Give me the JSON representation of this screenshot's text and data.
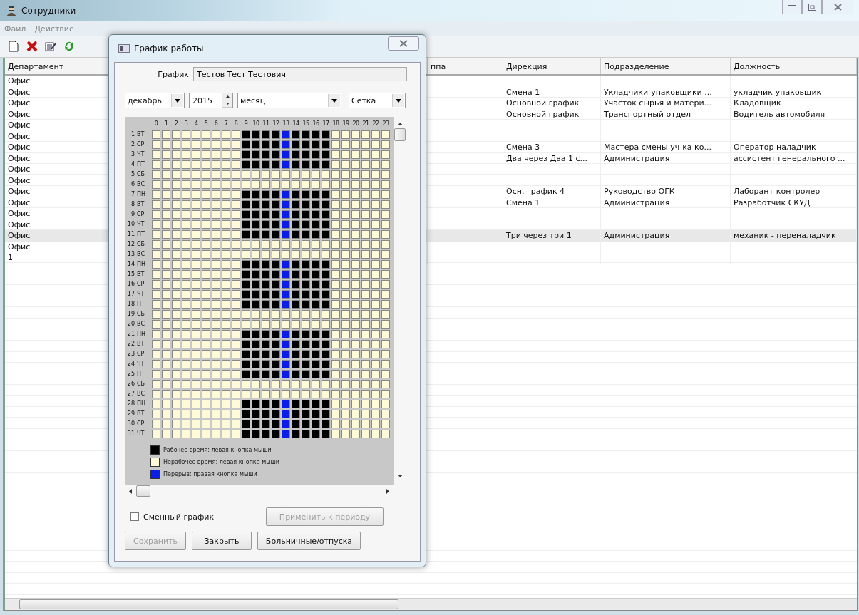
{
  "window": {
    "title": "Сотрудники"
  },
  "menu": [
    "Файл",
    "Действие"
  ],
  "table": {
    "columns": [
      "Департамент",
      "",
      "ппа",
      "Дирекция",
      "Подразделение",
      "Должность"
    ],
    "rows": [
      {
        "department": "Офис",
        "direction": "",
        "division": "",
        "position": "",
        "selected": false
      },
      {
        "department": "Офис",
        "direction": "Смена 1",
        "division": "Укладчики-упаковщики ...",
        "position": "укладчик-упаковщик",
        "selected": false
      },
      {
        "department": "Офис",
        "direction": "Основной график",
        "division": "Участок сырья и матери...",
        "position": "Кладовщик",
        "selected": false
      },
      {
        "department": "Офис",
        "direction": "Основной график",
        "division": "Транспортный отдел",
        "position": "Водитель автомобиля",
        "selected": false
      },
      {
        "department": "Офис",
        "direction": "",
        "division": "",
        "position": "",
        "selected": false
      },
      {
        "department": "Офис",
        "direction": "",
        "division": "",
        "position": "",
        "selected": false
      },
      {
        "department": "Офис",
        "direction": "Смена 3",
        "division": "Мастера смены уч-ка ко...",
        "position": "Оператор наладчик",
        "selected": false
      },
      {
        "department": "Офис",
        "direction": "Два через Два 1 с...",
        "division": "Администрация",
        "position": "ассистент генерального ...",
        "selected": false
      },
      {
        "department": "Офис",
        "direction": "",
        "division": "",
        "position": "",
        "selected": false
      },
      {
        "department": "Офис",
        "direction": "",
        "division": "",
        "position": "",
        "selected": false
      },
      {
        "department": "Офис",
        "direction": "Осн. график 4",
        "division": "Руководство ОГК",
        "position": "Лаборант-контролер",
        "selected": false
      },
      {
        "department": "Офис",
        "direction": "Смена 1",
        "division": "Администрация",
        "position": "Разработчик СКУД",
        "selected": false
      },
      {
        "department": "Офис",
        "direction": "",
        "division": "",
        "position": "",
        "selected": false
      },
      {
        "department": "Офис",
        "direction": "",
        "division": "",
        "position": "",
        "selected": false
      },
      {
        "department": "Офис",
        "direction": "Три через три 1",
        "division": "Администрация",
        "position": "механик - переналадчик",
        "selected": true
      },
      {
        "department": "Офис",
        "direction": "",
        "division": "",
        "position": "",
        "selected": false
      },
      {
        "department": "1",
        "direction": "",
        "division": "",
        "position": "",
        "selected": false
      }
    ]
  },
  "dialog": {
    "title": "График работы",
    "name_label": "График",
    "name_value": "Тестов Тест Тестович",
    "month": "декабрь",
    "year": "2015",
    "period": "месяц",
    "view": "Сетка",
    "hours": [
      "0",
      "1",
      "2",
      "3",
      "4",
      "5",
      "6",
      "7",
      "8",
      "9",
      "10",
      "11",
      "12",
      "13",
      "14",
      "15",
      "16",
      "17",
      "18",
      "19",
      "20",
      "21",
      "22",
      "23"
    ],
    "days": [
      {
        "day": "1",
        "weekday": "ВТ",
        "work": [
          false,
          false,
          false,
          false,
          false,
          false,
          false,
          false,
          false,
          true,
          true,
          true,
          true,
          false,
          true,
          true,
          true,
          true,
          false,
          false,
          false,
          false,
          false,
          false
        ],
        "break": [
          false,
          false,
          false,
          false,
          false,
          false,
          false,
          false,
          false,
          false,
          false,
          false,
          false,
          true,
          false,
          false,
          false,
          false,
          false,
          false,
          false,
          false,
          false,
          false
        ]
      },
      {
        "day": "2",
        "weekday": "СР",
        "work": [
          false,
          false,
          false,
          false,
          false,
          false,
          false,
          false,
          false,
          true,
          true,
          true,
          true,
          false,
          true,
          true,
          true,
          true,
          false,
          false,
          false,
          false,
          false,
          false
        ],
        "break": [
          false,
          false,
          false,
          false,
          false,
          false,
          false,
          false,
          false,
          false,
          false,
          false,
          false,
          true,
          false,
          false,
          false,
          false,
          false,
          false,
          false,
          false,
          false,
          false
        ]
      },
      {
        "day": "3",
        "weekday": "ЧТ",
        "work": [
          false,
          false,
          false,
          false,
          false,
          false,
          false,
          false,
          false,
          true,
          true,
          true,
          true,
          false,
          true,
          true,
          true,
          true,
          false,
          false,
          false,
          false,
          false,
          false
        ],
        "break": [
          false,
          false,
          false,
          false,
          false,
          false,
          false,
          false,
          false,
          false,
          false,
          false,
          false,
          true,
          false,
          false,
          false,
          false,
          false,
          false,
          false,
          false,
          false,
          false
        ]
      },
      {
        "day": "4",
        "weekday": "ПТ",
        "work": [
          false,
          false,
          false,
          false,
          false,
          false,
          false,
          false,
          false,
          true,
          true,
          true,
          true,
          false,
          true,
          true,
          true,
          true,
          false,
          false,
          false,
          false,
          false,
          false
        ],
        "break": [
          false,
          false,
          false,
          false,
          false,
          false,
          false,
          false,
          false,
          false,
          false,
          false,
          false,
          true,
          false,
          false,
          false,
          false,
          false,
          false,
          false,
          false,
          false,
          false
        ]
      },
      {
        "day": "5",
        "weekday": "СБ",
        "work": [
          false,
          false,
          false,
          false,
          false,
          false,
          false,
          false,
          false,
          false,
          false,
          false,
          false,
          false,
          false,
          false,
          false,
          false,
          false,
          false,
          false,
          false,
          false,
          false
        ],
        "break": [
          false,
          false,
          false,
          false,
          false,
          false,
          false,
          false,
          false,
          false,
          false,
          false,
          false,
          false,
          false,
          false,
          false,
          false,
          false,
          false,
          false,
          false,
          false,
          false
        ]
      },
      {
        "day": "6",
        "weekday": "ВС",
        "work": [
          false,
          false,
          false,
          false,
          false,
          false,
          false,
          false,
          false,
          false,
          false,
          false,
          false,
          false,
          false,
          false,
          false,
          false,
          false,
          false,
          false,
          false,
          false,
          false
        ],
        "break": [
          false,
          false,
          false,
          false,
          false,
          false,
          false,
          false,
          false,
          false,
          false,
          false,
          false,
          false,
          false,
          false,
          false,
          false,
          false,
          false,
          false,
          false,
          false,
          false
        ]
      },
      {
        "day": "7",
        "weekday": "ПН",
        "work": [
          false,
          false,
          false,
          false,
          false,
          false,
          false,
          false,
          false,
          true,
          true,
          true,
          true,
          false,
          true,
          true,
          true,
          true,
          false,
          false,
          false,
          false,
          false,
          false
        ],
        "break": [
          false,
          false,
          false,
          false,
          false,
          false,
          false,
          false,
          false,
          false,
          false,
          false,
          false,
          true,
          false,
          false,
          false,
          false,
          false,
          false,
          false,
          false,
          false,
          false
        ]
      },
      {
        "day": "8",
        "weekday": "ВТ",
        "work": [
          false,
          false,
          false,
          false,
          false,
          false,
          false,
          false,
          false,
          true,
          true,
          true,
          true,
          false,
          true,
          true,
          true,
          true,
          false,
          false,
          false,
          false,
          false,
          false
        ],
        "break": [
          false,
          false,
          false,
          false,
          false,
          false,
          false,
          false,
          false,
          false,
          false,
          false,
          false,
          true,
          false,
          false,
          false,
          false,
          false,
          false,
          false,
          false,
          false,
          false
        ]
      },
      {
        "day": "9",
        "weekday": "СР",
        "work": [
          false,
          false,
          false,
          false,
          false,
          false,
          false,
          false,
          false,
          true,
          true,
          true,
          true,
          false,
          true,
          true,
          true,
          true,
          false,
          false,
          false,
          false,
          false,
          false
        ],
        "break": [
          false,
          false,
          false,
          false,
          false,
          false,
          false,
          false,
          false,
          false,
          false,
          false,
          false,
          true,
          false,
          false,
          false,
          false,
          false,
          false,
          false,
          false,
          false,
          false
        ]
      },
      {
        "day": "10",
        "weekday": "ЧТ",
        "work": [
          false,
          false,
          false,
          false,
          false,
          false,
          false,
          false,
          false,
          true,
          true,
          true,
          true,
          false,
          true,
          true,
          true,
          true,
          false,
          false,
          false,
          false,
          false,
          false
        ],
        "break": [
          false,
          false,
          false,
          false,
          false,
          false,
          false,
          false,
          false,
          false,
          false,
          false,
          false,
          true,
          false,
          false,
          false,
          false,
          false,
          false,
          false,
          false,
          false,
          false
        ]
      },
      {
        "day": "11",
        "weekday": "ПТ",
        "work": [
          false,
          false,
          false,
          false,
          false,
          false,
          false,
          false,
          false,
          true,
          true,
          true,
          true,
          false,
          true,
          true,
          true,
          true,
          false,
          false,
          false,
          false,
          false,
          false
        ],
        "break": [
          false,
          false,
          false,
          false,
          false,
          false,
          false,
          false,
          false,
          false,
          false,
          false,
          false,
          true,
          false,
          false,
          false,
          false,
          false,
          false,
          false,
          false,
          false,
          false
        ]
      },
      {
        "day": "12",
        "weekday": "СБ",
        "work": [
          false,
          false,
          false,
          false,
          false,
          false,
          false,
          false,
          false,
          false,
          false,
          false,
          false,
          false,
          false,
          false,
          false,
          false,
          false,
          false,
          false,
          false,
          false,
          false
        ],
        "break": [
          false,
          false,
          false,
          false,
          false,
          false,
          false,
          false,
          false,
          false,
          false,
          false,
          false,
          false,
          false,
          false,
          false,
          false,
          false,
          false,
          false,
          false,
          false,
          false
        ]
      },
      {
        "day": "13",
        "weekday": "ВС",
        "work": [
          false,
          false,
          false,
          false,
          false,
          false,
          false,
          false,
          false,
          false,
          false,
          false,
          false,
          false,
          false,
          false,
          false,
          false,
          false,
          false,
          false,
          false,
          false,
          false
        ],
        "break": [
          false,
          false,
          false,
          false,
          false,
          false,
          false,
          false,
          false,
          false,
          false,
          false,
          false,
          false,
          false,
          false,
          false,
          false,
          false,
          false,
          false,
          false,
          false,
          false
        ]
      },
      {
        "day": "14",
        "weekday": "ПН",
        "work": [
          false,
          false,
          false,
          false,
          false,
          false,
          false,
          false,
          false,
          true,
          true,
          true,
          true,
          false,
          true,
          true,
          true,
          true,
          false,
          false,
          false,
          false,
          false,
          false
        ],
        "break": [
          false,
          false,
          false,
          false,
          false,
          false,
          false,
          false,
          false,
          false,
          false,
          false,
          false,
          true,
          false,
          false,
          false,
          false,
          false,
          false,
          false,
          false,
          false,
          false
        ]
      },
      {
        "day": "15",
        "weekday": "ВТ",
        "work": [
          false,
          false,
          false,
          false,
          false,
          false,
          false,
          false,
          false,
          true,
          true,
          true,
          true,
          false,
          true,
          true,
          true,
          true,
          false,
          false,
          false,
          false,
          false,
          false
        ],
        "break": [
          false,
          false,
          false,
          false,
          false,
          false,
          false,
          false,
          false,
          false,
          false,
          false,
          false,
          true,
          false,
          false,
          false,
          false,
          false,
          false,
          false,
          false,
          false,
          false
        ]
      },
      {
        "day": "16",
        "weekday": "СР",
        "work": [
          false,
          false,
          false,
          false,
          false,
          false,
          false,
          false,
          false,
          true,
          true,
          true,
          true,
          false,
          true,
          true,
          true,
          true,
          false,
          false,
          false,
          false,
          false,
          false
        ],
        "break": [
          false,
          false,
          false,
          false,
          false,
          false,
          false,
          false,
          false,
          false,
          false,
          false,
          false,
          true,
          false,
          false,
          false,
          false,
          false,
          false,
          false,
          false,
          false,
          false
        ]
      },
      {
        "day": "17",
        "weekday": "ЧТ",
        "work": [
          false,
          false,
          false,
          false,
          false,
          false,
          false,
          false,
          false,
          true,
          true,
          true,
          true,
          false,
          true,
          true,
          true,
          true,
          false,
          false,
          false,
          false,
          false,
          false
        ],
        "break": [
          false,
          false,
          false,
          false,
          false,
          false,
          false,
          false,
          false,
          false,
          false,
          false,
          false,
          true,
          false,
          false,
          false,
          false,
          false,
          false,
          false,
          false,
          false,
          false
        ]
      },
      {
        "day": "18",
        "weekday": "ПТ",
        "work": [
          false,
          false,
          false,
          false,
          false,
          false,
          false,
          false,
          false,
          true,
          true,
          true,
          true,
          false,
          true,
          true,
          true,
          true,
          false,
          false,
          false,
          false,
          false,
          false
        ],
        "break": [
          false,
          false,
          false,
          false,
          false,
          false,
          false,
          false,
          false,
          false,
          false,
          false,
          false,
          true,
          false,
          false,
          false,
          false,
          false,
          false,
          false,
          false,
          false,
          false
        ]
      },
      {
        "day": "19",
        "weekday": "СБ",
        "work": [
          false,
          false,
          false,
          false,
          false,
          false,
          false,
          false,
          false,
          false,
          false,
          false,
          false,
          false,
          false,
          false,
          false,
          false,
          false,
          false,
          false,
          false,
          false,
          false
        ],
        "break": [
          false,
          false,
          false,
          false,
          false,
          false,
          false,
          false,
          false,
          false,
          false,
          false,
          false,
          false,
          false,
          false,
          false,
          false,
          false,
          false,
          false,
          false,
          false,
          false
        ]
      },
      {
        "day": "20",
        "weekday": "ВС",
        "work": [
          false,
          false,
          false,
          false,
          false,
          false,
          false,
          false,
          false,
          false,
          false,
          false,
          false,
          false,
          false,
          false,
          false,
          false,
          false,
          false,
          false,
          false,
          false,
          false
        ],
        "break": [
          false,
          false,
          false,
          false,
          false,
          false,
          false,
          false,
          false,
          false,
          false,
          false,
          false,
          false,
          false,
          false,
          false,
          false,
          false,
          false,
          false,
          false,
          false,
          false
        ]
      },
      {
        "day": "21",
        "weekday": "ПН",
        "work": [
          false,
          false,
          false,
          false,
          false,
          false,
          false,
          false,
          false,
          true,
          true,
          true,
          true,
          false,
          true,
          true,
          true,
          true,
          false,
          false,
          false,
          false,
          false,
          false
        ],
        "break": [
          false,
          false,
          false,
          false,
          false,
          false,
          false,
          false,
          false,
          false,
          false,
          false,
          false,
          true,
          false,
          false,
          false,
          false,
          false,
          false,
          false,
          false,
          false,
          false
        ]
      },
      {
        "day": "22",
        "weekday": "ВТ",
        "work": [
          false,
          false,
          false,
          false,
          false,
          false,
          false,
          false,
          false,
          true,
          true,
          true,
          true,
          false,
          true,
          true,
          true,
          true,
          false,
          false,
          false,
          false,
          false,
          false
        ],
        "break": [
          false,
          false,
          false,
          false,
          false,
          false,
          false,
          false,
          false,
          false,
          false,
          false,
          false,
          true,
          false,
          false,
          false,
          false,
          false,
          false,
          false,
          false,
          false,
          false
        ]
      },
      {
        "day": "23",
        "weekday": "СР",
        "work": [
          false,
          false,
          false,
          false,
          false,
          false,
          false,
          false,
          false,
          true,
          true,
          true,
          true,
          false,
          true,
          true,
          true,
          true,
          false,
          false,
          false,
          false,
          false,
          false
        ],
        "break": [
          false,
          false,
          false,
          false,
          false,
          false,
          false,
          false,
          false,
          false,
          false,
          false,
          false,
          true,
          false,
          false,
          false,
          false,
          false,
          false,
          false,
          false,
          false,
          false
        ]
      },
      {
        "day": "24",
        "weekday": "ЧТ",
        "work": [
          false,
          false,
          false,
          false,
          false,
          false,
          false,
          false,
          false,
          true,
          true,
          true,
          true,
          false,
          true,
          true,
          true,
          true,
          false,
          false,
          false,
          false,
          false,
          false
        ],
        "break": [
          false,
          false,
          false,
          false,
          false,
          false,
          false,
          false,
          false,
          false,
          false,
          false,
          false,
          true,
          false,
          false,
          false,
          false,
          false,
          false,
          false,
          false,
          false,
          false
        ]
      },
      {
        "day": "25",
        "weekday": "ПТ",
        "work": [
          false,
          false,
          false,
          false,
          false,
          false,
          false,
          false,
          false,
          true,
          true,
          true,
          true,
          false,
          true,
          true,
          true,
          true,
          false,
          false,
          false,
          false,
          false,
          false
        ],
        "break": [
          false,
          false,
          false,
          false,
          false,
          false,
          false,
          false,
          false,
          false,
          false,
          false,
          false,
          true,
          false,
          false,
          false,
          false,
          false,
          false,
          false,
          false,
          false,
          false
        ]
      },
      {
        "day": "26",
        "weekday": "СБ",
        "work": [
          false,
          false,
          false,
          false,
          false,
          false,
          false,
          false,
          false,
          false,
          false,
          false,
          false,
          false,
          false,
          false,
          false,
          false,
          false,
          false,
          false,
          false,
          false,
          false
        ],
        "break": [
          false,
          false,
          false,
          false,
          false,
          false,
          false,
          false,
          false,
          false,
          false,
          false,
          false,
          false,
          false,
          false,
          false,
          false,
          false,
          false,
          false,
          false,
          false,
          false
        ]
      },
      {
        "day": "27",
        "weekday": "ВС",
        "work": [
          false,
          false,
          false,
          false,
          false,
          false,
          false,
          false,
          false,
          false,
          false,
          false,
          false,
          false,
          false,
          false,
          false,
          false,
          false,
          false,
          false,
          false,
          false,
          false
        ],
        "break": [
          false,
          false,
          false,
          false,
          false,
          false,
          false,
          false,
          false,
          false,
          false,
          false,
          false,
          false,
          false,
          false,
          false,
          false,
          false,
          false,
          false,
          false,
          false,
          false
        ]
      },
      {
        "day": "28",
        "weekday": "ПН",
        "work": [
          false,
          false,
          false,
          false,
          false,
          false,
          false,
          false,
          false,
          true,
          true,
          true,
          true,
          false,
          true,
          true,
          true,
          true,
          false,
          false,
          false,
          false,
          false,
          false
        ],
        "break": [
          false,
          false,
          false,
          false,
          false,
          false,
          false,
          false,
          false,
          false,
          false,
          false,
          false,
          true,
          false,
          false,
          false,
          false,
          false,
          false,
          false,
          false,
          false,
          false
        ]
      },
      {
        "day": "29",
        "weekday": "ВТ",
        "work": [
          false,
          false,
          false,
          false,
          false,
          false,
          false,
          false,
          false,
          true,
          true,
          true,
          true,
          false,
          true,
          true,
          true,
          true,
          false,
          false,
          false,
          false,
          false,
          false
        ],
        "break": [
          false,
          false,
          false,
          false,
          false,
          false,
          false,
          false,
          false,
          false,
          false,
          false,
          false,
          true,
          false,
          false,
          false,
          false,
          false,
          false,
          false,
          false,
          false,
          false
        ]
      },
      {
        "day": "30",
        "weekday": "СР",
        "work": [
          false,
          false,
          false,
          false,
          false,
          false,
          false,
          false,
          false,
          true,
          true,
          true,
          true,
          false,
          true,
          true,
          true,
          true,
          false,
          false,
          false,
          false,
          false,
          false
        ],
        "break": [
          false,
          false,
          false,
          false,
          false,
          false,
          false,
          false,
          false,
          false,
          false,
          false,
          false,
          true,
          false,
          false,
          false,
          false,
          false,
          false,
          false,
          false,
          false,
          false
        ]
      },
      {
        "day": "31",
        "weekday": "ЧТ",
        "work": [
          false,
          false,
          false,
          false,
          false,
          false,
          false,
          false,
          false,
          true,
          true,
          true,
          true,
          false,
          true,
          true,
          true,
          true,
          false,
          false,
          false,
          false,
          false,
          false
        ],
        "break": [
          false,
          false,
          false,
          false,
          false,
          false,
          false,
          false,
          false,
          false,
          false,
          false,
          false,
          true,
          false,
          false,
          false,
          false,
          false,
          false,
          false,
          false,
          false,
          false
        ]
      }
    ],
    "legend": [
      {
        "kind": "work",
        "color": "#000000",
        "label": "Рабочее время: левая кнопка мыши"
      },
      {
        "kind": "off",
        "color": "#fffbd8",
        "label": "Нерабочее время: левая кнопка мыши"
      },
      {
        "kind": "break",
        "color": "#0a1ee6",
        "label": "Перерыв: правая кнопка мыши"
      }
    ],
    "shift_schedule": {
      "label": "Сменный график",
      "checked": false
    },
    "apply": {
      "label": "Применить к периоду",
      "disabled": true
    },
    "buttons": [
      {
        "label": "Сохранить",
        "disabled": true
      },
      {
        "label": "Закрыть",
        "disabled": false
      },
      {
        "label": "Больничные/отпуска",
        "disabled": false
      }
    ]
  }
}
